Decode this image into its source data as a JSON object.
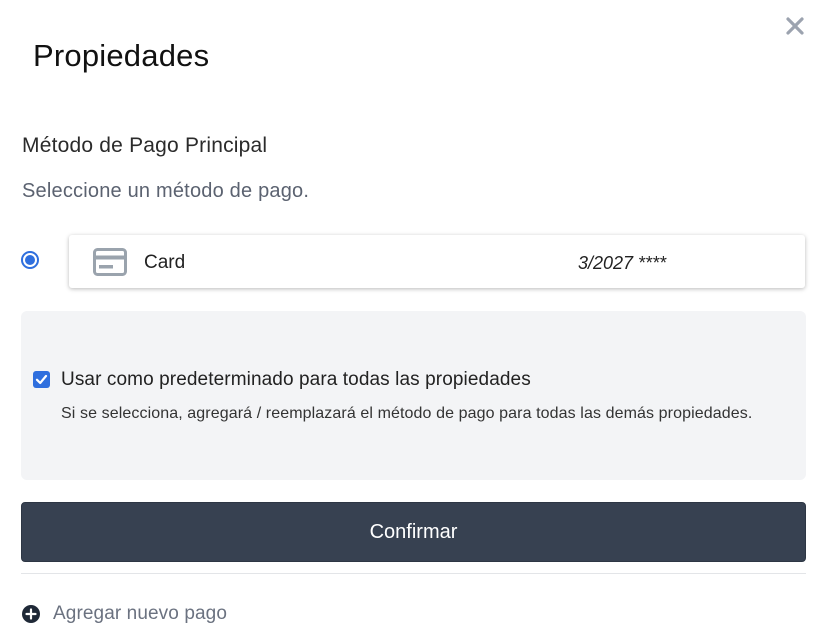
{
  "dialog": {
    "title": "Propiedades",
    "close_icon": "close-icon"
  },
  "payment_section": {
    "heading": "Método de Pago Principal",
    "subheading": "Seleccione un método de pago."
  },
  "payment_methods": [
    {
      "selected": true,
      "icon": "credit-card-icon",
      "label": "Card",
      "expiry_masked": "3/2027 ****"
    }
  ],
  "default_option": {
    "checked": true,
    "label": "Usar como predeterminado para todas las propiedades",
    "description": "Si se selecciona, agregará / reemplazará el método de pago para todas las demás propiedades."
  },
  "actions": {
    "confirm_label": "Confirmar",
    "add_payment_label": "Agregar nuevo pago",
    "add_icon": "plus-circle-icon"
  },
  "colors": {
    "accent": "#2f6fde",
    "button_bg": "#374151",
    "panel_bg": "#f3f4f6",
    "muted_text": "#6b7280"
  }
}
